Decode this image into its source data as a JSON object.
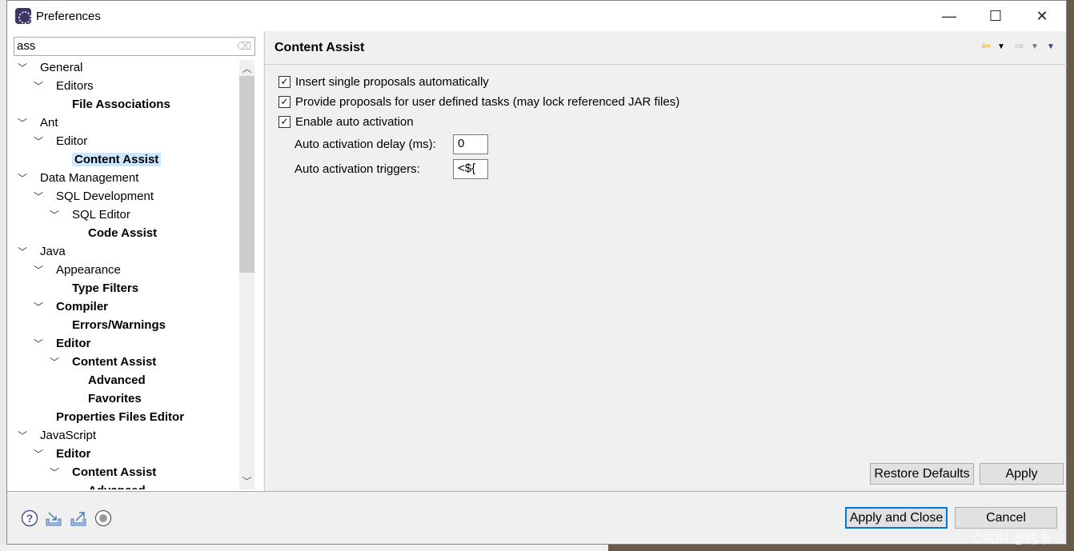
{
  "window": {
    "title": "Preferences",
    "minimize": "—",
    "maximize": "☐",
    "close": "✕"
  },
  "search": {
    "value": "ass"
  },
  "tree": [
    {
      "label": "General",
      "level": 0,
      "expanded": true,
      "bold": false
    },
    {
      "label": "Editors",
      "level": 1,
      "expanded": true,
      "bold": false
    },
    {
      "label": "File Associations",
      "level": 2,
      "bold": true
    },
    {
      "label": "Ant",
      "level": 0,
      "expanded": true,
      "bold": false
    },
    {
      "label": "Editor",
      "level": 1,
      "expanded": true,
      "bold": false
    },
    {
      "label": "Content Assist",
      "level": 2,
      "bold": true,
      "selected": true
    },
    {
      "label": "Data Management",
      "level": 0,
      "expanded": true,
      "bold": false
    },
    {
      "label": "SQL Development",
      "level": 1,
      "expanded": true,
      "bold": false
    },
    {
      "label": "SQL Editor",
      "level": 2,
      "expanded": true,
      "bold": false
    },
    {
      "label": "Code Assist",
      "level": 3,
      "bold": true
    },
    {
      "label": "Java",
      "level": 0,
      "expanded": true,
      "bold": false
    },
    {
      "label": "Appearance",
      "level": 1,
      "expanded": true,
      "bold": false
    },
    {
      "label": "Type Filters",
      "level": 2,
      "bold": true
    },
    {
      "label": "Compiler",
      "level": 1,
      "expanded": true,
      "bold": true
    },
    {
      "label": "Errors/Warnings",
      "level": 2,
      "bold": true
    },
    {
      "label": "Editor",
      "level": 1,
      "expanded": true,
      "bold": true
    },
    {
      "label": "Content Assist",
      "level": 2,
      "expanded": true,
      "bold": true
    },
    {
      "label": "Advanced",
      "level": 3,
      "bold": true
    },
    {
      "label": "Favorites",
      "level": 3,
      "bold": true
    },
    {
      "label": "Properties Files Editor",
      "level": 1,
      "bold": true
    },
    {
      "label": "JavaScript",
      "level": 0,
      "expanded": true,
      "bold": false
    },
    {
      "label": "Editor",
      "level": 1,
      "expanded": true,
      "bold": true
    },
    {
      "label": "Content Assist",
      "level": 2,
      "expanded": true,
      "bold": true
    },
    {
      "label": "Advanced",
      "level": 3,
      "bold": true
    }
  ],
  "page": {
    "title": "Content Assist",
    "checkboxes": [
      {
        "label": "Insert single proposals automatically",
        "checked": true
      },
      {
        "label": "Provide proposals for user defined tasks (may lock referenced JAR files)",
        "checked": true
      },
      {
        "label": "Enable auto activation",
        "checked": true
      }
    ],
    "delay_label": "Auto activation delay (ms):",
    "delay_value": "0",
    "triggers_label": "Auto activation triggers:",
    "triggers_value": "<${",
    "restore_defaults": "Restore Defaults",
    "apply": "Apply"
  },
  "footer": {
    "apply_close": "Apply and Close",
    "cancel": "Cancel"
  },
  "watermark": "CSDN @约卡",
  "colors": {
    "selection": "#cce8ff",
    "default_button_border": "#0078d7",
    "back_arrow": "#e8a317"
  }
}
